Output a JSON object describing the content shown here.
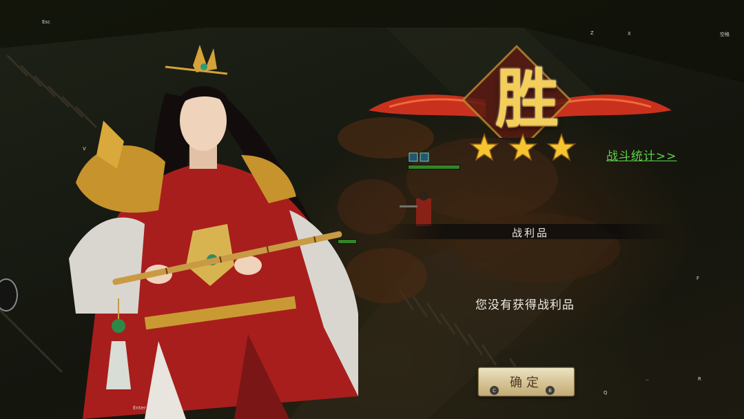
{
  "hotkeys": {
    "esc": "Esc",
    "z": "Z",
    "x": "X",
    "space": "空格",
    "v": "V",
    "f": "F",
    "r": "R",
    "q": "Q",
    "enter": "Enter",
    "dots": "..",
    "c": "C",
    "b": "B"
  },
  "result": {
    "victory_char": "胜",
    "stars": 3,
    "max_stars": 3,
    "battle_stats_link": "战斗统计>>"
  },
  "loot": {
    "title": "战利品",
    "empty_message": "您没有获得战利品"
  },
  "buttons": {
    "confirm": "确定"
  },
  "colors": {
    "victory_gold": "#f3cf5a",
    "star_gold": "#f5c431",
    "stats_green": "#5ed34a",
    "ribbon_red": "#c9311e",
    "button_face": "#d8c598"
  }
}
